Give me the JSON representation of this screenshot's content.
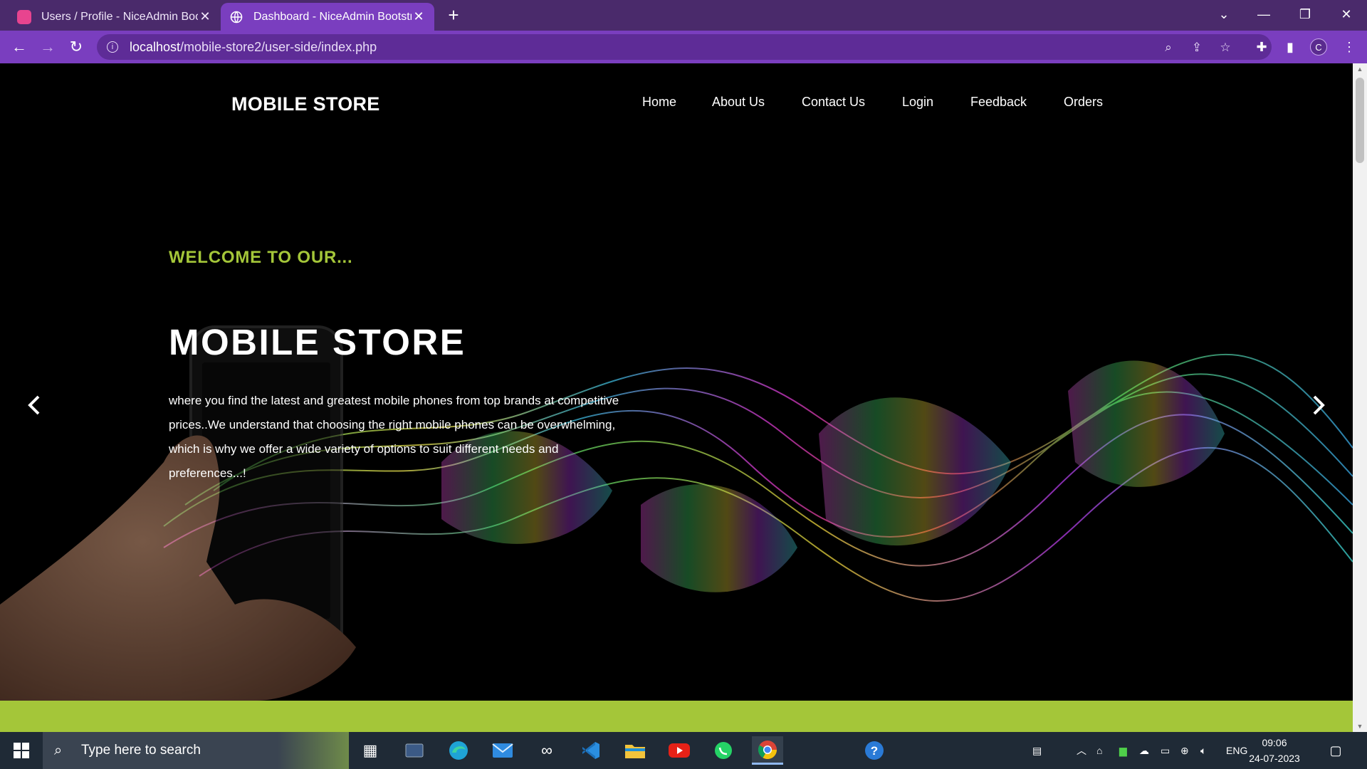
{
  "browser": {
    "tabs": [
      {
        "title": "Users / Profile - NiceAdmin Bootstrap Template",
        "favicon": "niceadmin-logo-icon",
        "active": false
      },
      {
        "title": "Dashboard - NiceAdmin Bootstrap Template",
        "favicon": "globe-icon",
        "active": true
      }
    ],
    "url_host": "localhost",
    "url_path": "/mobile-store2/user-side/index.php",
    "profile_initial": "C",
    "accent": "#7a3ebf"
  },
  "site": {
    "brand": "MOBILE STORE",
    "nav": [
      "Home",
      "About Us",
      "Contact Us",
      "Login",
      "Feedback",
      "Orders"
    ],
    "hero": {
      "eyebrow": "WELCOME TO OUR...",
      "title": "MOBILE STORE",
      "text": "where you find the latest and greatest mobile phones from top brands at competitive prices..We understand that choosing the right mobile phones can be overwhelming, which is why we offer a wide variety of options to suit different needs and preferences...!"
    },
    "accent_green": "#a4c639"
  },
  "taskbar": {
    "search_placeholder": "Type here to search",
    "language": "ENG",
    "time": "09:06",
    "date": "24-07-2023"
  }
}
